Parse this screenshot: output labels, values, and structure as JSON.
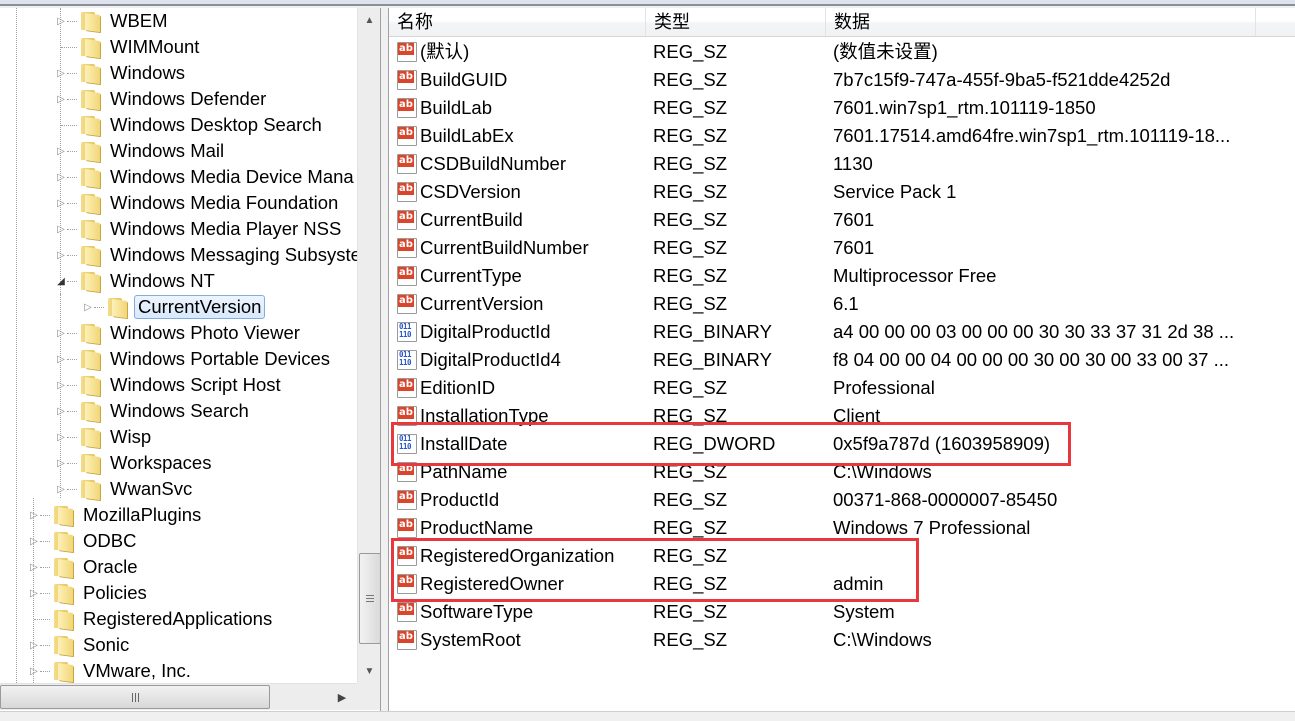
{
  "tree": {
    "items": [
      {
        "label": "WBEM",
        "level": 2,
        "expander": "collapsed"
      },
      {
        "label": "WIMMount",
        "level": 2,
        "expander": "none"
      },
      {
        "label": "Windows",
        "level": 2,
        "expander": "collapsed"
      },
      {
        "label": "Windows Defender",
        "level": 2,
        "expander": "collapsed"
      },
      {
        "label": "Windows Desktop Search",
        "level": 2,
        "expander": "none"
      },
      {
        "label": "Windows Mail",
        "level": 2,
        "expander": "collapsed"
      },
      {
        "label": "Windows Media Device Mana",
        "level": 2,
        "expander": "collapsed"
      },
      {
        "label": "Windows Media Foundation",
        "level": 2,
        "expander": "collapsed"
      },
      {
        "label": "Windows Media Player NSS",
        "level": 2,
        "expander": "collapsed"
      },
      {
        "label": "Windows Messaging Subsyste",
        "level": 2,
        "expander": "collapsed"
      },
      {
        "label": "Windows NT",
        "level": 2,
        "expander": "expanded"
      },
      {
        "label": "CurrentVersion",
        "level": 3,
        "expander": "collapsed",
        "selected": true
      },
      {
        "label": "Windows Photo Viewer",
        "level": 2,
        "expander": "collapsed"
      },
      {
        "label": "Windows Portable Devices",
        "level": 2,
        "expander": "collapsed"
      },
      {
        "label": "Windows Script Host",
        "level": 2,
        "expander": "collapsed"
      },
      {
        "label": "Windows Search",
        "level": 2,
        "expander": "collapsed"
      },
      {
        "label": "Wisp",
        "level": 2,
        "expander": "collapsed"
      },
      {
        "label": "Workspaces",
        "level": 2,
        "expander": "collapsed"
      },
      {
        "label": "WwanSvc",
        "level": 2,
        "expander": "collapsed"
      },
      {
        "label": "MozillaPlugins",
        "level": 1,
        "expander": "collapsed"
      },
      {
        "label": "ODBC",
        "level": 1,
        "expander": "collapsed"
      },
      {
        "label": "Oracle",
        "level": 1,
        "expander": "collapsed"
      },
      {
        "label": "Policies",
        "level": 1,
        "expander": "collapsed"
      },
      {
        "label": "RegisteredApplications",
        "level": 1,
        "expander": "none"
      },
      {
        "label": "Sonic",
        "level": 1,
        "expander": "collapsed"
      },
      {
        "label": "VMware, Inc.",
        "level": 1,
        "expander": "collapsed"
      }
    ],
    "scroll": {
      "up_arrow": "▲",
      "down_arrow": "▼",
      "right_arrow": "▶"
    },
    "expander_glyphs": {
      "collapsed": "▷",
      "expanded": "◢"
    }
  },
  "list": {
    "columns": {
      "name": "名称",
      "type": "类型",
      "data": "数据"
    },
    "rows": [
      {
        "icon": "string-value-icon",
        "name": "(默认)",
        "type": "REG_SZ",
        "data": "(数值未设置)"
      },
      {
        "icon": "string-value-icon",
        "name": "BuildGUID",
        "type": "REG_SZ",
        "data": "7b7c15f9-747a-455f-9ba5-f521dde4252d"
      },
      {
        "icon": "string-value-icon",
        "name": "BuildLab",
        "type": "REG_SZ",
        "data": "7601.win7sp1_rtm.101119-1850"
      },
      {
        "icon": "string-value-icon",
        "name": "BuildLabEx",
        "type": "REG_SZ",
        "data": "7601.17514.amd64fre.win7sp1_rtm.101119-18..."
      },
      {
        "icon": "string-value-icon",
        "name": "CSDBuildNumber",
        "type": "REG_SZ",
        "data": "1130"
      },
      {
        "icon": "string-value-icon",
        "name": "CSDVersion",
        "type": "REG_SZ",
        "data": "Service Pack 1"
      },
      {
        "icon": "string-value-icon",
        "name": "CurrentBuild",
        "type": "REG_SZ",
        "data": "7601"
      },
      {
        "icon": "string-value-icon",
        "name": "CurrentBuildNumber",
        "type": "REG_SZ",
        "data": "7601"
      },
      {
        "icon": "string-value-icon",
        "name": "CurrentType",
        "type": "REG_SZ",
        "data": "Multiprocessor Free"
      },
      {
        "icon": "string-value-icon",
        "name": "CurrentVersion",
        "type": "REG_SZ",
        "data": "6.1"
      },
      {
        "icon": "binary-value-icon",
        "name": "DigitalProductId",
        "type": "REG_BINARY",
        "data": "a4 00 00 00 03 00 00 00 30 30 33 37 31 2d 38 ..."
      },
      {
        "icon": "binary-value-icon",
        "name": "DigitalProductId4",
        "type": "REG_BINARY",
        "data": "f8 04 00 00 04 00 00 00 30 00 30 00 33 00 37 ..."
      },
      {
        "icon": "string-value-icon",
        "name": "EditionID",
        "type": "REG_SZ",
        "data": "Professional"
      },
      {
        "icon": "string-value-icon",
        "name": "InstallationType",
        "type": "REG_SZ",
        "data": "Client"
      },
      {
        "icon": "binary-value-icon",
        "name": "InstallDate",
        "type": "REG_DWORD",
        "data": "0x5f9a787d (1603958909)"
      },
      {
        "icon": "string-value-icon",
        "name": "PathName",
        "type": "REG_SZ",
        "data": "C:\\Windows"
      },
      {
        "icon": "string-value-icon",
        "name": "ProductId",
        "type": "REG_SZ",
        "data": "00371-868-0000007-85450"
      },
      {
        "icon": "string-value-icon",
        "name": "ProductName",
        "type": "REG_SZ",
        "data": "Windows 7 Professional"
      },
      {
        "icon": "string-value-icon",
        "name": "RegisteredOrganization",
        "type": "REG_SZ",
        "data": ""
      },
      {
        "icon": "string-value-icon",
        "name": "RegisteredOwner",
        "type": "REG_SZ",
        "data": "admin"
      },
      {
        "icon": "string-value-icon",
        "name": "SoftwareType",
        "type": "REG_SZ",
        "data": "System"
      },
      {
        "icon": "string-value-icon",
        "name": "SystemRoot",
        "type": "REG_SZ",
        "data": "C:\\Windows"
      }
    ],
    "icon_glyphs": {
      "string": "ab",
      "binary": "011\n110"
    }
  },
  "annotations": {
    "highlight_color": "#e8383d",
    "boxes": [
      {
        "covers": [
          "InstallDate"
        ]
      },
      {
        "covers": [
          "RegisteredOrganization",
          "RegisteredOwner"
        ]
      }
    ]
  }
}
